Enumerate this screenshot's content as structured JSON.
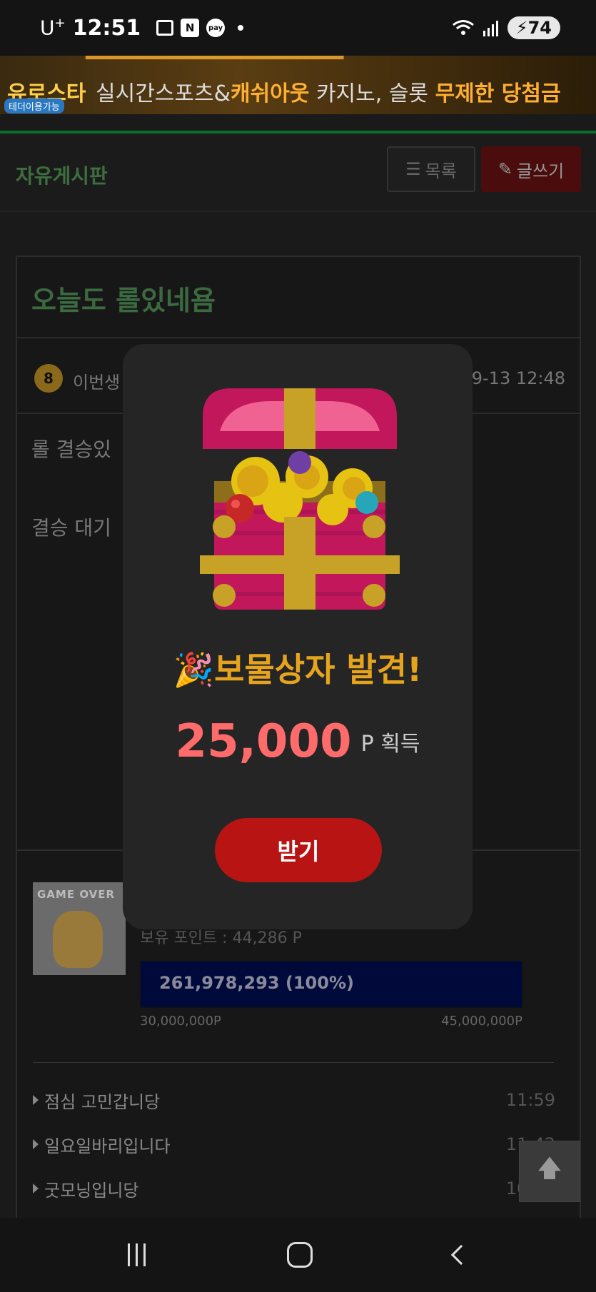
{
  "status_bar": {
    "carrier": "U",
    "carrier_sup": "+",
    "time": "12:51",
    "battery": "74"
  },
  "banner": {
    "brand": "유로스타",
    "tag": "테더이용가능",
    "copy_a": "실시간스포츠&",
    "copy_b": "캐쉬아웃",
    "copy_c": " 카지노, 슬롯 ",
    "copy_d": "무제한 당첨금"
  },
  "board": {
    "title": "자유게시판",
    "list_button": "목록",
    "write_button": "글쓰기"
  },
  "post": {
    "title": "오늘도 롤있네욤",
    "level": "8",
    "author": "이번생",
    "date": "09-13 12:48",
    "body_line1": "롤 결승있",
    "body_line2": "결승 대기",
    "points_label": "보유 포인트 : 44,286 P",
    "progress_text": "261,978,293 (100%)",
    "progress_fraction": 1.0,
    "progress_min": "30,000,000P",
    "progress_max": "45,000,000P",
    "profile_caption": "GAME OVER"
  },
  "related_posts": [
    {
      "title": "점심 고민갑니당",
      "time": "11:59"
    },
    {
      "title": "일요일바리입니다",
      "time": "11:42"
    },
    {
      "title": "굿모닝입니당",
      "time": "10:48"
    }
  ],
  "modal": {
    "title": "🎉보물상자 발견!",
    "amount": "25,000",
    "unit": "P 획득",
    "claim_button": "받기"
  },
  "colors": {
    "accent_gold": "#e6a41d",
    "reward_red": "#ff6b6b",
    "button_red": "#b91414",
    "board_green": "#3e6e40"
  }
}
